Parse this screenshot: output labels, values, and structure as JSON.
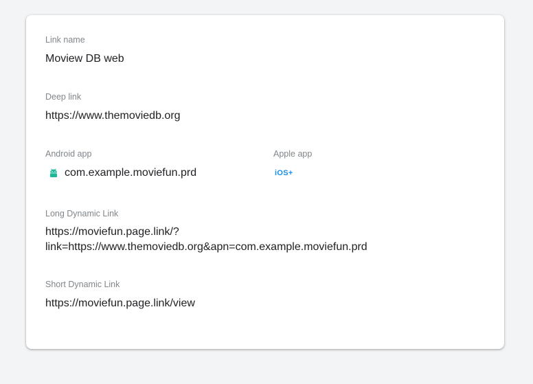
{
  "link_name": {
    "label": "Link name",
    "value": "Moview DB web"
  },
  "deep_link": {
    "label": "Deep link",
    "value": "https://www.themoviedb.org"
  },
  "android_app": {
    "label": "Android app",
    "value": "com.example.moviefun.prd",
    "icon": "android-icon"
  },
  "apple_app": {
    "label": "Apple app",
    "badge": "iOS+",
    "icon": "ios-icon"
  },
  "long_dynamic_link": {
    "label": "Long Dynamic Link",
    "line1": "https://moviefun.page.link/?",
    "line2": "link=https://www.themoviedb.org&apn=com.example.moviefun.prd"
  },
  "short_dynamic_link": {
    "label": "Short Dynamic Link",
    "value": "https://moviefun.page.link/view"
  },
  "colors": {
    "android": "#20b89a",
    "ios": "#1a8ee6",
    "label": "#80868b",
    "text": "#202124"
  }
}
